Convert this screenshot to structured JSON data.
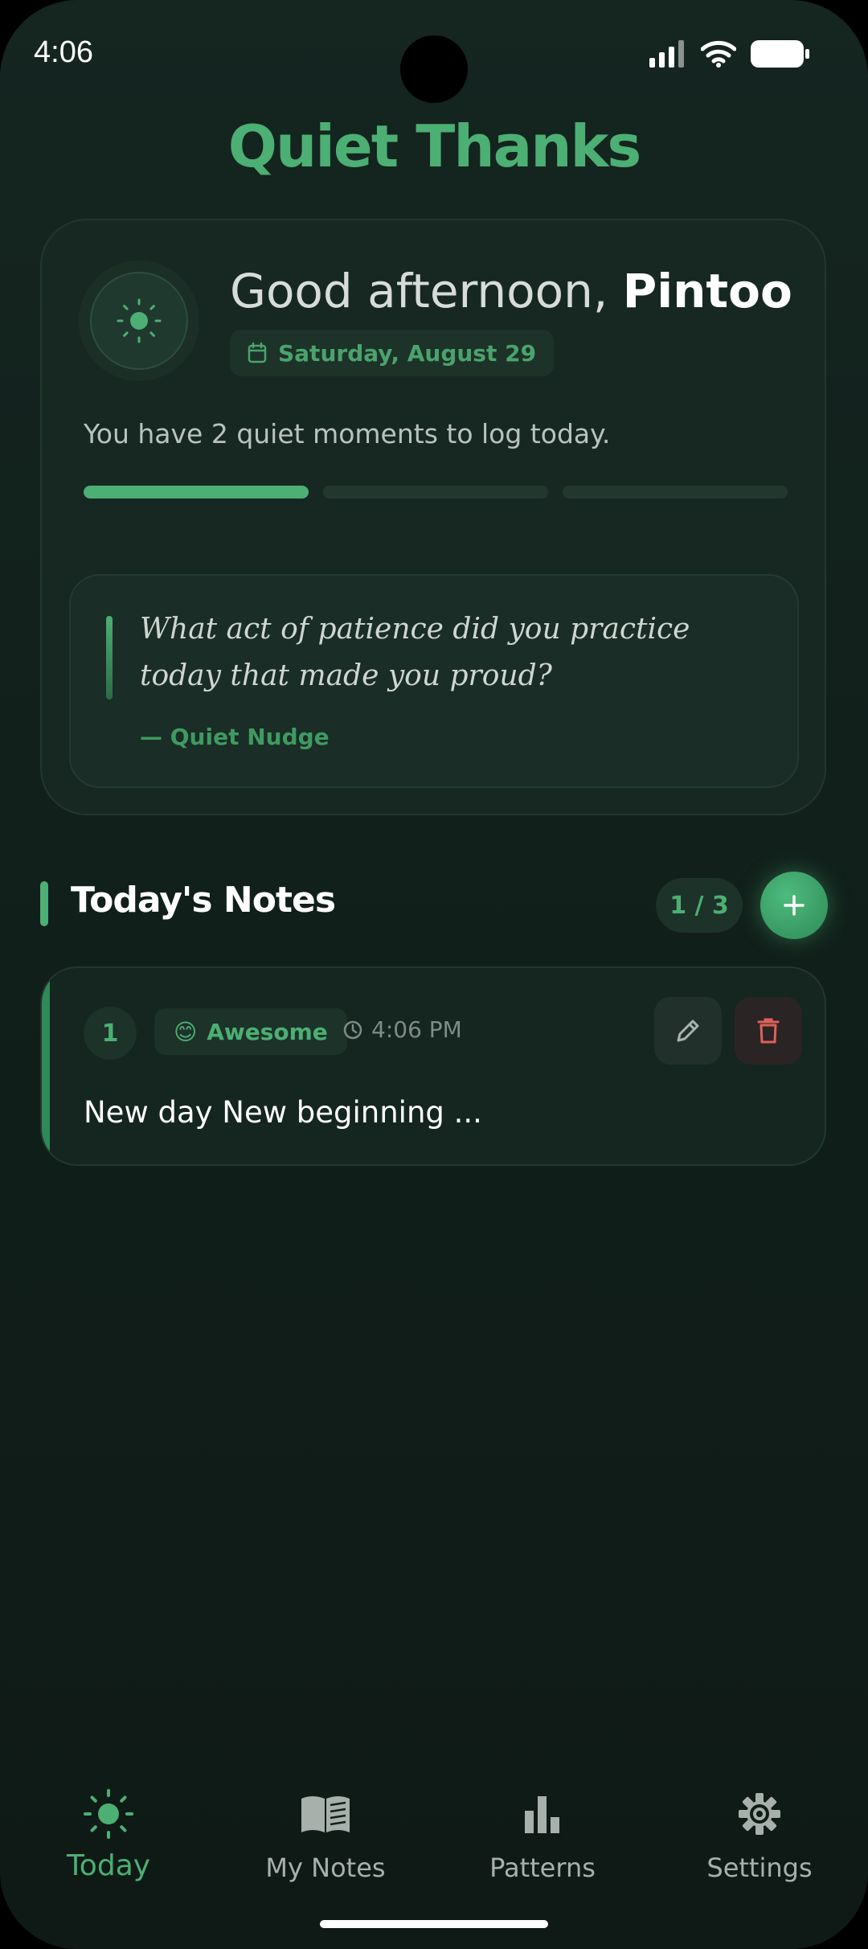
{
  "status_bar": {
    "time": "4:06"
  },
  "app": {
    "title": "Quiet Thanks"
  },
  "greeting": {
    "salutation": "Good afternoon, ",
    "name": "Pintoo",
    "date": "Saturday, August 29",
    "moments_text": "You have 2 quiet moments to log today.",
    "progress_segments_filled": 1,
    "progress_segments_total": 3
  },
  "nudge": {
    "prompt": "What act of patience did you practice today that made you proud?",
    "source": "— Quiet Nudge"
  },
  "notes_section": {
    "title": "Today's Notes",
    "count": "1 / 3"
  },
  "notes": [
    {
      "number": "1",
      "mood_emoji": "😊",
      "mood": "Awesome",
      "time": "4:06 PM",
      "text": "New day New beginning ..."
    }
  ],
  "nav": {
    "items": [
      {
        "label": "Today",
        "icon": "sun-icon",
        "active": true
      },
      {
        "label": "My Notes",
        "icon": "book-icon",
        "active": false
      },
      {
        "label": "Patterns",
        "icon": "bar-chart-icon",
        "active": false
      },
      {
        "label": "Settings",
        "icon": "gear-icon",
        "active": false
      }
    ]
  },
  "colors": {
    "accent": "#4caf73",
    "background": "#11201b",
    "card": "#172822",
    "danger": "#e0605a"
  }
}
